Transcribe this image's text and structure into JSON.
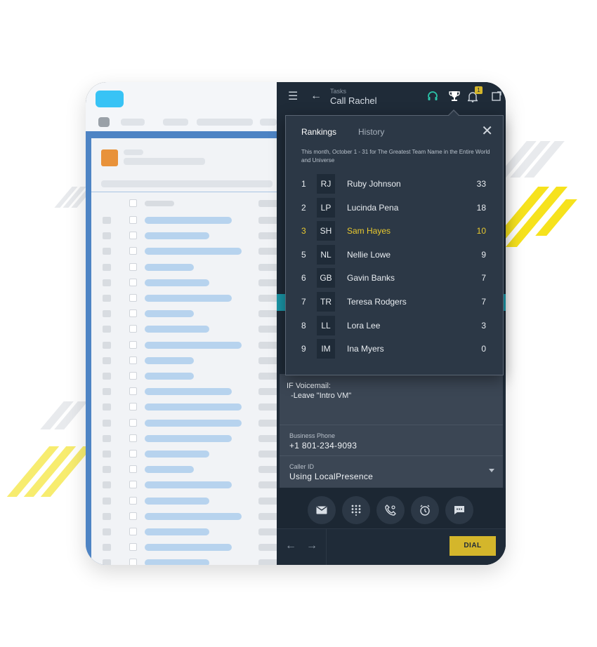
{
  "header": {
    "breadcrumb_label": "Tasks",
    "task_title": "Call Rachel",
    "notification_count": "1"
  },
  "rankings": {
    "tabs": [
      {
        "label": "Rankings"
      },
      {
        "label": "History"
      }
    ],
    "description": "This month, October 1 - 31 for The Greatest Team Name in the Entire World and Universe",
    "highlight_color": "#e8c92f",
    "rows": [
      {
        "rank": "1",
        "initials": "RJ",
        "name": "Ruby Johnson",
        "score": "33"
      },
      {
        "rank": "2",
        "initials": "LP",
        "name": "Lucinda Pena",
        "score": "18"
      },
      {
        "rank": "3",
        "initials": "SH",
        "name": "Sam Hayes",
        "score": "10"
      },
      {
        "rank": "5",
        "initials": "NL",
        "name": "Nellie Lowe",
        "score": "9"
      },
      {
        "rank": "6",
        "initials": "GB",
        "name": "Gavin Banks",
        "score": "7"
      },
      {
        "rank": "7",
        "initials": "TR",
        "name": "Teresa Rodgers",
        "score": "7"
      },
      {
        "rank": "8",
        "initials": "LL",
        "name": "Lora Lee",
        "score": "3"
      },
      {
        "rank": "9",
        "initials": "IM",
        "name": "Ina Myers",
        "score": "0"
      }
    ]
  },
  "task": {
    "voicemail_text": "IF Voicemail:\n  -Leave \"Intro VM\"",
    "business_phone_label": "Business Phone",
    "business_phone_value": "+1 801-234-9093",
    "caller_id_label": "Caller ID",
    "caller_id_value": "Using LocalPresence"
  },
  "footer": {
    "dial_label": "DIAL"
  },
  "colors": {
    "accent_yellow": "#d4b62b",
    "dark_bg": "#1f2b38",
    "panel_bg": "#2c3846"
  }
}
